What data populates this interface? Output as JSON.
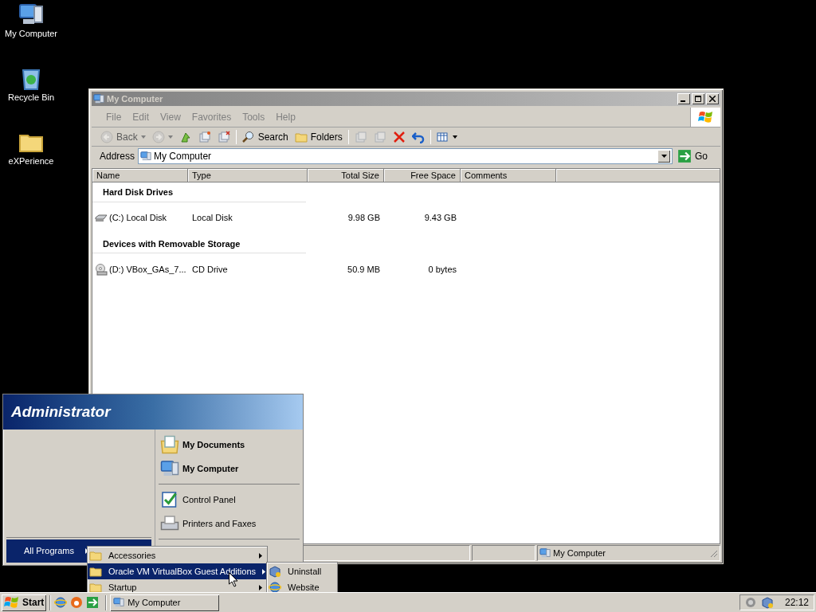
{
  "desktop_icons": [
    {
      "kind": "computer",
      "label": "My Computer"
    },
    {
      "kind": "bin",
      "label": "Recycle Bin"
    },
    {
      "kind": "folder",
      "label": "eXPerience"
    }
  ],
  "window": {
    "title": "My Computer",
    "active": false,
    "menu": [
      "File",
      "Edit",
      "View",
      "Favorites",
      "Tools",
      "Help"
    ],
    "toolbar": [
      {
        "kind": "back",
        "label": "Back",
        "disabled": true
      },
      {
        "kind": "forward",
        "disabled": true
      },
      {
        "kind": "up",
        "disabled": false
      },
      {
        "kind": "moveto",
        "disabled": false
      },
      {
        "kind": "copyto",
        "disabled": false
      },
      {
        "kind": "sep"
      },
      {
        "kind": "search",
        "label": "Search",
        "disabled": false
      },
      {
        "kind": "folders",
        "label": "Folders",
        "disabled": false
      },
      {
        "kind": "sep"
      },
      {
        "kind": "move",
        "disabled": true
      },
      {
        "kind": "copy",
        "disabled": true
      },
      {
        "kind": "delete",
        "disabled": false
      },
      {
        "kind": "undo",
        "disabled": false
      },
      {
        "kind": "sep"
      },
      {
        "kind": "views",
        "disabled": false
      }
    ],
    "address": {
      "label": "Address",
      "value": "My Computer",
      "go": "Go"
    },
    "columns": [
      "Name",
      "Type",
      "Total Size",
      "Free Space",
      "Comments"
    ],
    "groups": [
      {
        "title": "Hard Disk Drives",
        "items": [
          {
            "kind": "disk",
            "name": "(C:) Local Disk",
            "type": "Local Disk",
            "total": "9.98 GB",
            "free": "9.43 GB"
          }
        ]
      },
      {
        "title": "Devices with Removable Storage",
        "items": [
          {
            "kind": "cd",
            "name": "(D:) VBox_GAs_7...",
            "type": "CD Drive",
            "total": "50.9 MB",
            "free": "0 bytes"
          }
        ]
      }
    ],
    "status_bar": {
      "location": "My Computer"
    }
  },
  "start_menu": {
    "user": "Administrator",
    "right_groups": [
      [
        {
          "kind": "documents",
          "label": "My Documents",
          "bold": true
        },
        {
          "kind": "computer",
          "label": "My Computer",
          "bold": true
        }
      ],
      [
        {
          "kind": "panel",
          "label": "Control Panel",
          "bold": false
        },
        {
          "kind": "printer",
          "label": "Printers and Faxes",
          "bold": false
        }
      ]
    ],
    "all_programs": {
      "label": "All Programs",
      "selected": true
    }
  },
  "programs_menu": [
    {
      "label": "Accessories",
      "selected": false
    },
    {
      "label": "Oracle VM VirtualBox Guest Additions",
      "selected": true
    },
    {
      "label": "Startup",
      "selected": false
    }
  ],
  "submenu": [
    {
      "kind": "box",
      "label": "Uninstall"
    },
    {
      "kind": "globe",
      "label": "Website"
    }
  ],
  "taskbar": {
    "start": "Start",
    "quick_launch": [
      {
        "kind": "ie"
      },
      {
        "kind": "media"
      },
      {
        "kind": "arrow"
      }
    ],
    "tasks": [
      {
        "label": "My Computer",
        "selected": false
      }
    ],
    "clock": "22:12"
  }
}
